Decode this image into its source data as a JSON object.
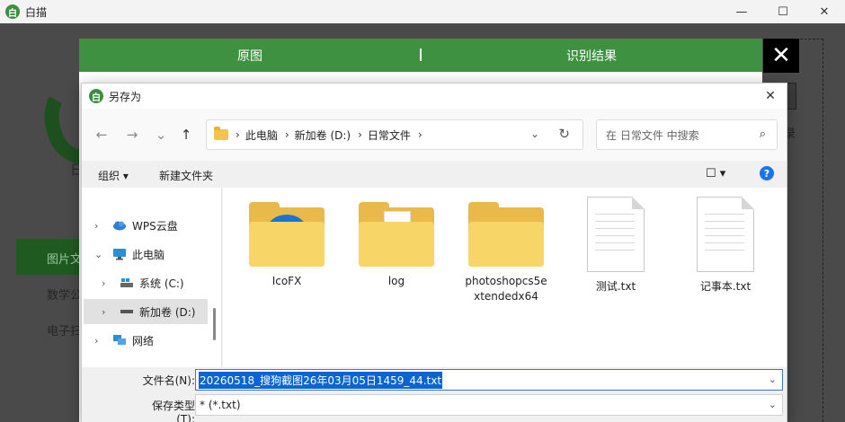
{
  "app": {
    "title": "白描",
    "logo_glyph": "白",
    "side_text": "日",
    "side_selected": "图片文",
    "side_items": [
      "数学公",
      "电子扫"
    ],
    "right_peek_text": "录"
  },
  "window_controls": {
    "minimize": "—",
    "maximize": "☐",
    "close": "✕"
  },
  "panel": {
    "tabs": [
      "原图",
      "识别结果"
    ],
    "separator": "|",
    "close_glyph": "✕"
  },
  "dialog": {
    "title": "另存为",
    "close_glyph": "✕",
    "nav": {
      "back": "←",
      "forward": "→",
      "recent": "⌄",
      "up": "↑"
    },
    "breadcrumb": [
      "此电脑",
      "新加卷 (D:)",
      "日常文件"
    ],
    "breadcrumb_sep": "›",
    "address_dropdown": "⌄",
    "refresh": "↻",
    "search_placeholder": "在 日常文件 中搜索",
    "search_glyph": "⌕",
    "toolbar": {
      "organize": "组织 ▾",
      "new_folder": "新建文件夹",
      "view": "☐ ▾",
      "help": "?"
    },
    "tree": [
      {
        "label": "WPS云盘",
        "chevron": "›"
      },
      {
        "label": "此电脑",
        "chevron": "⌄"
      },
      {
        "label": "系统 (C:)",
        "chevron": "›"
      },
      {
        "label": "新加卷 (D:)",
        "chevron": "›"
      },
      {
        "label": "网络",
        "chevron": "›"
      }
    ],
    "files": [
      {
        "name": "IcoFX",
        "type": "folder"
      },
      {
        "name": "log",
        "type": "folder"
      },
      {
        "name": "photoshopcs5extendedx64",
        "type": "folder"
      },
      {
        "name": "测试.txt",
        "type": "text"
      },
      {
        "name": "记事本.txt",
        "type": "text"
      }
    ],
    "filename_label": "文件名(N):",
    "filename_value": "20260518_搜狗截图26年03月05日1459_44.txt",
    "filetype_label": "保存类型(T):",
    "filetype_value": "* (*.txt)",
    "dropdown_glyph": "⌄"
  },
  "colors": {
    "accent_green": "#3d9141",
    "folder_yellow": "#f7d567",
    "selection_blue": "#0a64d2"
  }
}
